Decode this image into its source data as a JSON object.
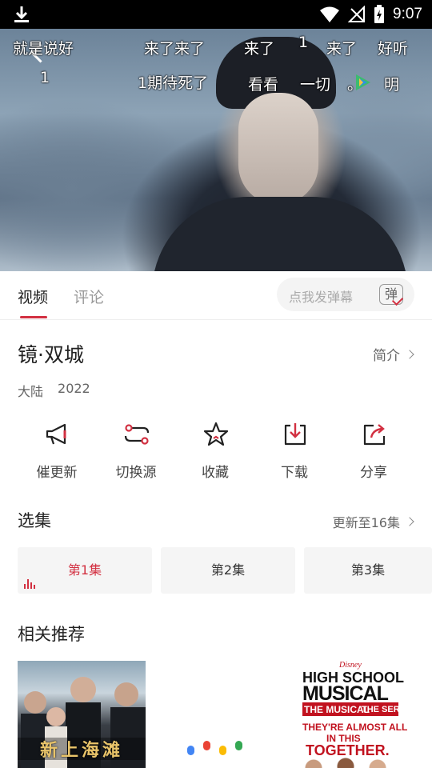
{
  "status_bar": {
    "time": "9:07"
  },
  "danmaku": [
    "就是说好",
    "来了来了",
    "来了",
    "1",
    "来了",
    "好听",
    "1",
    "1期待死了",
    "看看",
    "一切",
    "。",
    "明"
  ],
  "tabs": {
    "video": "视频",
    "comments": "评论"
  },
  "danmu_input": {
    "placeholder": "点我发弹幕",
    "button": "弹"
  },
  "show": {
    "title": "镜·双城",
    "intro_link": "简介",
    "region": "大陆",
    "year": "2022"
  },
  "actions": [
    {
      "label": "催更新",
      "icon": "megaphone-icon"
    },
    {
      "label": "切换源",
      "icon": "switch-source-icon"
    },
    {
      "label": "收藏",
      "icon": "star-icon"
    },
    {
      "label": "下载",
      "icon": "download-icon"
    },
    {
      "label": "分享",
      "icon": "share-icon"
    }
  ],
  "episodes": {
    "title": "选集",
    "update_status": "更新至16集",
    "items": [
      "第1集",
      "第2集",
      "第3集"
    ],
    "selected_index": 0
  },
  "recommend": {
    "title": "相关推荐",
    "posters": [
      {
        "title": "新上海滩"
      },
      {
        "title": ""
      },
      {
        "brand": "Disney",
        "title_line1": "HIGH SCHOOL",
        "title_line2": "MUSICAL",
        "subtitle_a": "THE MUSICAL",
        "subtitle_b": "THE SERIES",
        "tagline1": "THEY'RE ALMOST ALL",
        "tagline2": "IN THIS",
        "tagline3": "TOGETHER."
      }
    ]
  },
  "colors": {
    "accent": "#d23041",
    "status_bar": "#000000"
  }
}
